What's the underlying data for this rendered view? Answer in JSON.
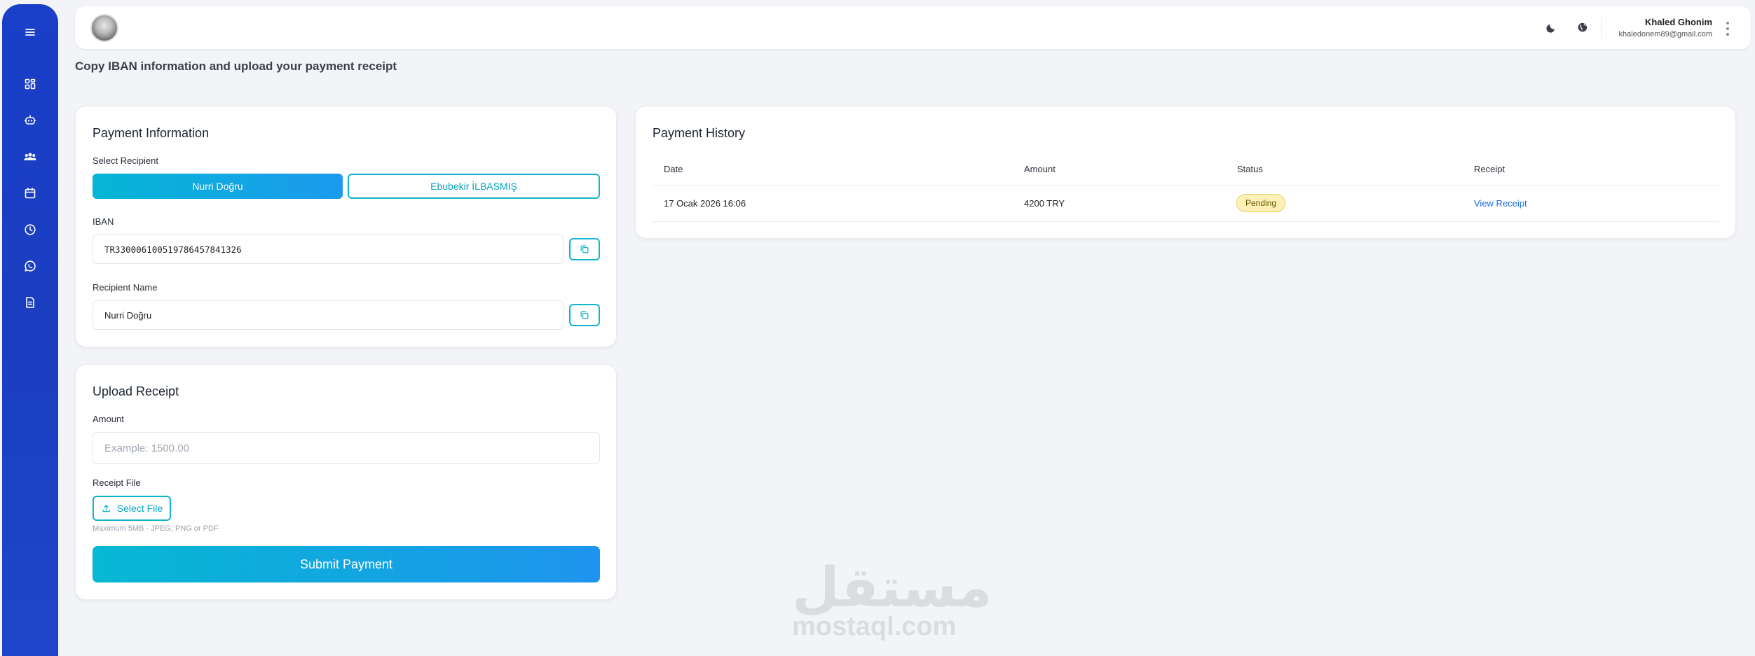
{
  "sidebar": {
    "items": [
      {
        "icon": "menu-icon"
      },
      {
        "icon": "dashboard-icon"
      },
      {
        "icon": "robot-icon"
      },
      {
        "icon": "users-icon"
      },
      {
        "icon": "calendar-icon"
      },
      {
        "icon": "clock-icon"
      },
      {
        "icon": "whatsapp-icon"
      },
      {
        "icon": "document-icon"
      }
    ]
  },
  "header": {
    "user_name": "Khaled Ghonim",
    "user_email": "khaledonem89@gmail.com",
    "icons": [
      "moon-icon",
      "globe-icon",
      "more-vertical-icon"
    ]
  },
  "page": {
    "subtitle": "Copy IBAN information and upload your payment receipt"
  },
  "payment_info": {
    "title": "Payment Information",
    "select_recipient_label": "Select Recipient",
    "recipients": [
      "Nurri Doğru",
      "Ebubekir İLBASMIŞ"
    ],
    "selected_recipient": "Nurri Doğru",
    "iban_label": "IBAN",
    "iban_value": "TR330006100519786457841326",
    "recipient_name_label": "Recipient Name",
    "recipient_name_value": "Nurri Doğru"
  },
  "upload_receipt": {
    "title": "Upload Receipt",
    "amount_label": "Amount",
    "amount_placeholder": "Example: 1500.00",
    "file_label": "Receipt File",
    "select_file_label": "Select File",
    "hint": "Maximum 5MB - JPEG, PNG or PDF",
    "submit_label": "Submit Payment"
  },
  "payment_history": {
    "title": "Payment History",
    "columns": [
      "Date",
      "Amount",
      "Status",
      "Receipt"
    ],
    "rows": [
      {
        "date": "17 Ocak 2026 16:06",
        "amount": "4200 TRY",
        "status": "Pending",
        "receipt": "View Receipt"
      }
    ]
  },
  "watermark": {
    "arabic": "مستقل",
    "latin": "mostaql.com"
  },
  "colors": {
    "sidebar": "#1b3ec0",
    "accent": "#10b4cc",
    "link": "#1e6fe0",
    "pending_badge": "#fdf1b8"
  }
}
